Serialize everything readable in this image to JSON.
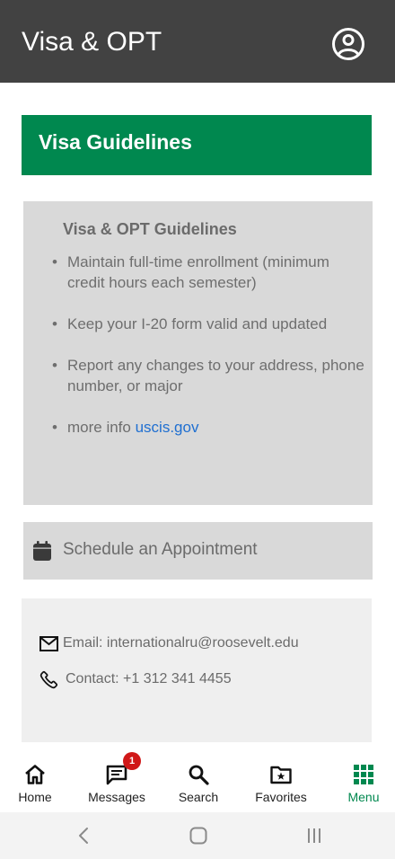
{
  "app_bar": {
    "title": "Visa & OPT",
    "profile_icon": "account-circle-icon"
  },
  "banner": {
    "title": "Visa Guidelines",
    "color": "#00884f"
  },
  "guidelines": {
    "heading": "Visa & OPT Guidelines",
    "items": [
      {
        "text": "Maintain full-time enrollment (minimum credit hours each semester)"
      },
      {
        "text": "Keep your I-20 form valid and updated"
      },
      {
        "text": "Report any changes to your address, phone number, or major"
      },
      {
        "prefix": "more info ",
        "link": "uscis.gov"
      }
    ]
  },
  "appointment": {
    "label": "Schedule an Appointment",
    "icon": "calendar-icon"
  },
  "contact": {
    "email": "Email: internationalru@roosevelt.edu",
    "phone": "Contact: +1 312 341 4455"
  },
  "bottom_nav": {
    "items": [
      {
        "label": "Home",
        "icon": "home-icon"
      },
      {
        "label": "Messages",
        "icon": "messages-icon",
        "badge": "1"
      },
      {
        "label": "Search",
        "icon": "search-icon"
      },
      {
        "label": "Favorites",
        "icon": "favorites-folder-icon"
      },
      {
        "label": "Menu",
        "icon": "grid-menu-icon",
        "active": true
      }
    ],
    "active_color": "#00884f"
  },
  "system_nav": {
    "buttons": [
      "back-icon",
      "home-circle-icon",
      "recents-icon"
    ]
  }
}
